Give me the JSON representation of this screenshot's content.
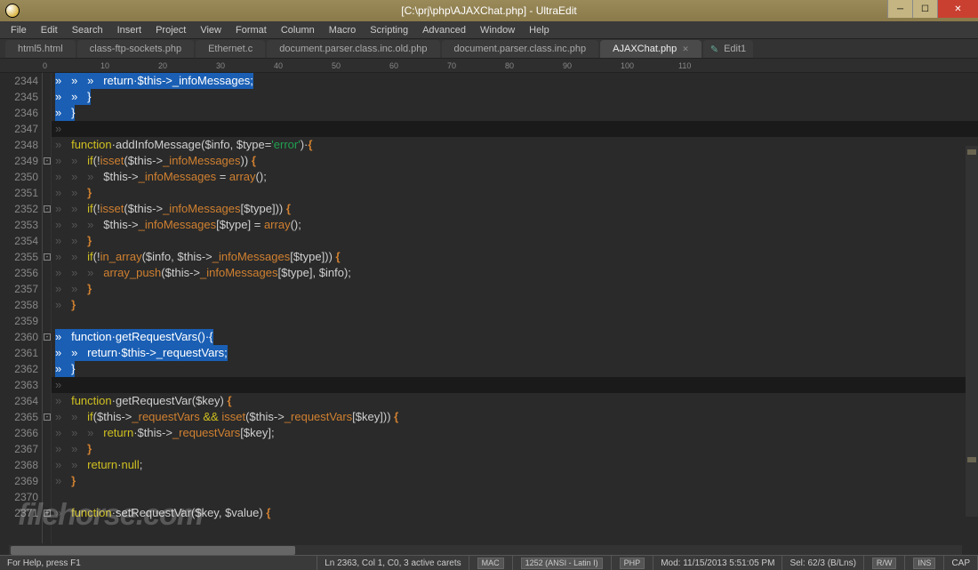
{
  "window": {
    "title": "[C:\\prj\\php\\AJAXChat.php] - UltraEdit"
  },
  "menu": [
    "File",
    "Edit",
    "Search",
    "Insert",
    "Project",
    "View",
    "Format",
    "Column",
    "Macro",
    "Scripting",
    "Advanced",
    "Window",
    "Help"
  ],
  "tabs": [
    {
      "label": "html5.html",
      "active": false
    },
    {
      "label": "class-ftp-sockets.php",
      "active": false
    },
    {
      "label": "Ethernet.c",
      "active": false
    },
    {
      "label": "document.parser.class.inc.old.php",
      "active": false
    },
    {
      "label": "document.parser.class.inc.php",
      "active": false
    },
    {
      "label": "AJAXChat.php",
      "active": true,
      "close": true
    }
  ],
  "new_tab": "Edit1",
  "ruler_marks": [
    "0",
    "10",
    "20",
    "30",
    "40",
    "50",
    "60",
    "70",
    "80",
    "90",
    "100",
    "110"
  ],
  "lines_start": 2344,
  "lines_end": 2371,
  "statusbar": {
    "help": "For Help, press F1",
    "pos": "Ln 2363, Col 1, C0, 3 active carets",
    "eol": "MAC",
    "cp": "1252 (ANSI - Latin I)",
    "lang": "PHP",
    "mod": "Mod: 11/15/2013 5:51:05 PM",
    "sel": "Sel: 62/3 (B/Lns)",
    "rw": "R/W",
    "ins": "INS",
    "cap": "CAP"
  },
  "watermark": "filehorse.com",
  "code": {
    "ws": "»   ",
    "sel1_a": "»   »   »   return·$this->_infoMessages;",
    "sel1_b": "»   »   }",
    "sel1_c": "»   }",
    "ws_single": "»",
    "fn_addInfo": "addInfoMessage",
    "fn_getReqVars": "getRequestVars",
    "fn_getReqVar": "getRequestVar",
    "fn_setReqVar": "setRequestVar",
    "kw_function": "function",
    "kw_return": "return",
    "kw_if": "if",
    "kw_null": "null",
    "fn_isset": "isset",
    "fn_array": "array",
    "fn_in_array": "in_array",
    "fn_array_push": "array_push",
    "var_info": "$info",
    "var_type": "$type",
    "var_key": "$key",
    "var_value": "$value",
    "this": "$this",
    "prop_infoMsg": "_infoMessages",
    "prop_reqVars": "_requestVars",
    "str_error": "'error'",
    "sel2_a": "»   function·getRequestVars()·{",
    "sel2_b": "»   »   return·$this->_requestVars;",
    "sel2_c": "»   }",
    "and": "&&"
  }
}
